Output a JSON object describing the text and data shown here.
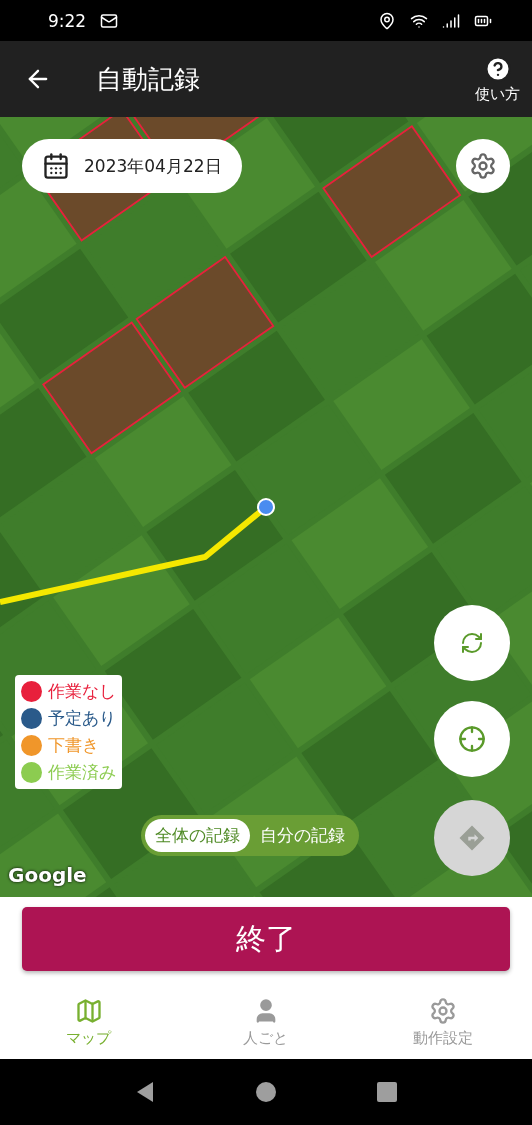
{
  "status_bar": {
    "time": "9:22"
  },
  "app_bar": {
    "title": "自動記録",
    "help_label": "使い方"
  },
  "map": {
    "date": "2023年04月22日",
    "attribution": "Google",
    "legend": [
      {
        "label": "作業なし",
        "color": "#e8203c"
      },
      {
        "label": "予定あり",
        "color": "#2a5a8a"
      },
      {
        "label": "下書き",
        "color": "#f0962a"
      },
      {
        "label": "作業済み",
        "color": "#8ccc50"
      }
    ],
    "toggle": [
      {
        "label": "全体の記録",
        "selected": true
      },
      {
        "label": "自分の記録",
        "selected": false
      }
    ],
    "buttons": [
      {
        "kind": "refresh",
        "disabled": false
      },
      {
        "kind": "locate",
        "disabled": false
      },
      {
        "kind": "directions",
        "disabled": true
      }
    ]
  },
  "end_button": "終了",
  "nav": [
    {
      "label": "マップ",
      "kind": "map",
      "selected": true
    },
    {
      "label": "人ごと",
      "kind": "person",
      "selected": false
    },
    {
      "label": "動作設定",
      "kind": "settings",
      "selected": false
    }
  ]
}
